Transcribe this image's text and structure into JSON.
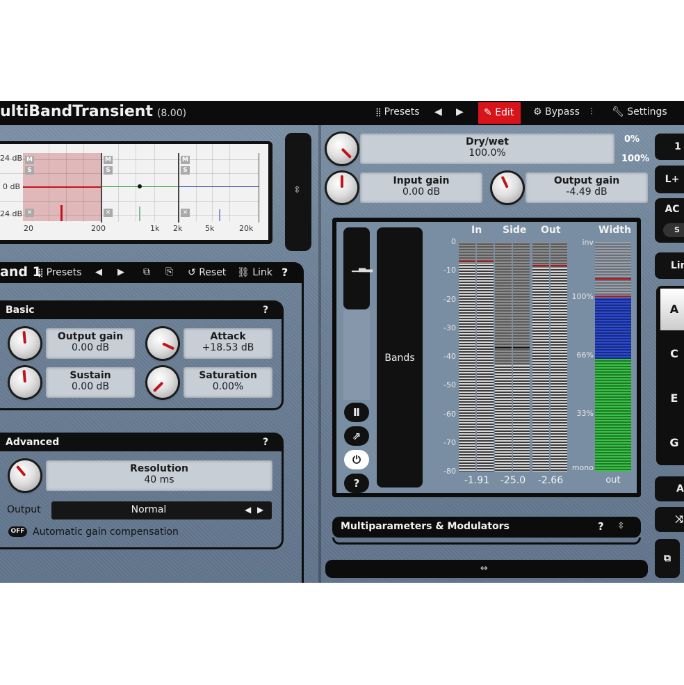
{
  "titlebar": {
    "title": "ultiBandTransient",
    "version": "(8.00)",
    "presets": "Presets",
    "edit": "Edit",
    "bypass": "Bypass",
    "settings": "Settings"
  },
  "eq": {
    "db_labels": [
      "24 dB",
      "0 dB",
      "24 dB"
    ],
    "freq_labels": [
      "20",
      "200",
      "1k",
      "2k",
      "5k",
      "20k"
    ],
    "band_buttons": [
      "M",
      "S"
    ]
  },
  "band_bar": {
    "title": "and 1",
    "presets": "Presets",
    "reset": "Reset",
    "link": "Link",
    "help": "?"
  },
  "basic": {
    "header": "Basic",
    "help": "?",
    "output_gain_label": "Output gain",
    "output_gain_value": "0.00 dB",
    "attack_label": "Attack",
    "attack_value": "+18.53 dB",
    "sustain_label": "Sustain",
    "sustain_value": "0.00 dB",
    "saturation_label": "Saturation",
    "saturation_value": "0.00%"
  },
  "advanced": {
    "header": "Advanced",
    "help": "?",
    "resolution_label": "Resolution",
    "resolution_value": "40 ms",
    "output_label": "Output",
    "output_value": "Normal",
    "agc_toggle": "OFF",
    "agc_label": "Automatic gain compensation"
  },
  "global": {
    "drywet_label": "Dry/wet",
    "drywet_value": "100.0%",
    "drywet_min": "0%",
    "drywet_max": "100%",
    "input_gain_label": "Input gain",
    "input_gain_value": "0.00 dB",
    "output_gain_label": "Output gain",
    "output_gain_value": "-4.49 dB"
  },
  "meters": {
    "bands_button": "Bands",
    "col_in": "In",
    "col_side": "Side",
    "col_out": "Out",
    "col_width": "Width",
    "db_ticks": [
      "0",
      "-10",
      "-20",
      "-30",
      "-40",
      "-50",
      "-60",
      "-70",
      "-80"
    ],
    "width_ticks": [
      "inv",
      "100%",
      "66%",
      "33%",
      "mono"
    ],
    "in_value": "-1.91",
    "side_value": "-25.0",
    "out_value": "-2.66",
    "width_value": "out",
    "help": "?",
    "levels": {
      "in_db": -7.5,
      "side_db": -43,
      "out_db": -9
    }
  },
  "multiparams": {
    "label": "Multiparameters & Modulators",
    "help": "?"
  },
  "right_strip": {
    "items": [
      "1",
      "L+",
      "AC",
      "S",
      "Lim",
      "A",
      "C",
      "E",
      "G",
      "A/"
    ]
  },
  "colors": {
    "accent_red": "#d8141a",
    "panel_bg": "#6d8197",
    "meter_width_blue": "#2a4bd0",
    "meter_width_green": "#2fb33a"
  }
}
